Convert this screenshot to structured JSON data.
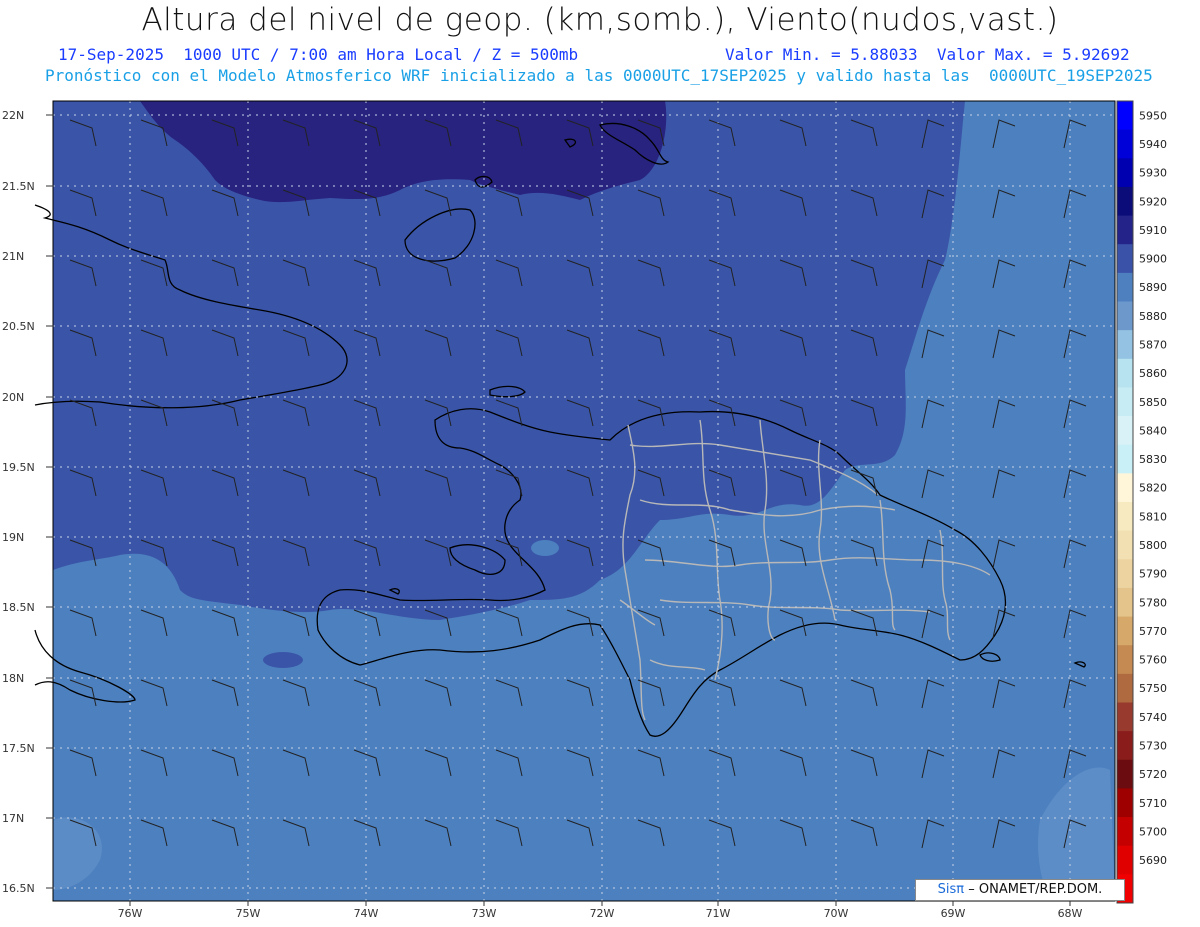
{
  "header": {
    "title": "Altura del nivel de geop. (km,somb.), Viento(nudos,vast.)",
    "line1_left": "17-Sep-2025  1000 UTC / 7:00 am Hora Local / Z = 500mb",
    "line1_right": "Valor Min. = 5.88033  Valor Max. = 5.92692",
    "line2": "Pronóstico con el Modelo Atmosferico WRF inicializado a las 0000UTC_17SEP2025 y valido hasta las  0000UTC_19SEP2025"
  },
  "lat_labels": [
    "22N",
    "21.5N",
    "21N",
    "20.5N",
    "20N",
    "19.5N",
    "19N",
    "18.5N",
    "18N",
    "17.5N",
    "17N",
    "16.5N"
  ],
  "lon_labels": [
    "76W",
    "75W",
    "74W",
    "73W",
    "72W",
    "71W",
    "70W",
    "69W",
    "68W"
  ],
  "colorbar": {
    "labels": [
      "5950",
      "5940",
      "5930",
      "5920",
      "5910",
      "5900",
      "5890",
      "5880",
      "5870",
      "5860",
      "5850",
      "5840",
      "5830",
      "5820",
      "5810",
      "5800",
      "5790",
      "5780",
      "5770",
      "5760",
      "5750",
      "5740",
      "5730",
      "5720",
      "5710",
      "5700",
      "5690"
    ],
    "colors": [
      "#0000ff",
      "#0000d8",
      "#0000b0",
      "#0b0b7a",
      "#23238a",
      "#3a52a8",
      "#4e7fbf",
      "#6c98cc",
      "#93c2e2",
      "#b7e3f0",
      "#c8ecf4",
      "#d9f2f8",
      "#c9f0f6",
      "#fff6d9",
      "#f7eac0",
      "#f2e0b2",
      "#ecd3a0",
      "#e4c48a",
      "#d6a86a",
      "#c48a52",
      "#b06a40",
      "#983a2e",
      "#8a1c1c",
      "#6a0c10",
      "#9e0000",
      "#c40000",
      "#e10000",
      "#f00000"
    ]
  },
  "legend_levels": {
    "deep": "#28237f",
    "mid": "#3a55a8",
    "light": "#4d80bf",
    "lighter": "#6a97cd"
  },
  "credit": {
    "sis": "Sisπ",
    "text": "– ONAMET/REP.DOM."
  }
}
